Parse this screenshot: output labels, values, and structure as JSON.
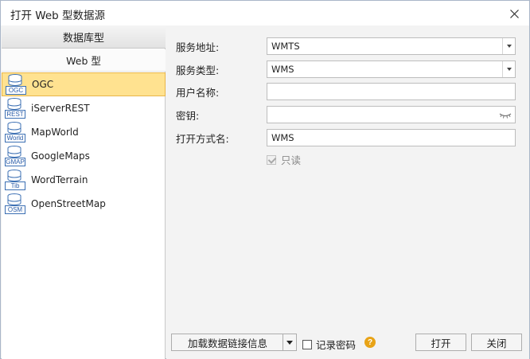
{
  "window": {
    "title": "打开 Web 型数据源"
  },
  "sidebar": {
    "header": "数据库型",
    "group": "Web 型",
    "items": [
      {
        "label": "OGC",
        "tag": "OGC",
        "selected": true,
        "icon": "database-icon"
      },
      {
        "label": "iServerREST",
        "tag": "REST",
        "selected": false,
        "icon": "database-icon"
      },
      {
        "label": "MapWorld",
        "tag": "World",
        "selected": false,
        "icon": "database-icon"
      },
      {
        "label": "GoogleMaps",
        "tag": "GMAP",
        "selected": false,
        "icon": "database-icon"
      },
      {
        "label": "WordTerrain",
        "tag": "Tib",
        "selected": false,
        "icon": "database-icon"
      },
      {
        "label": "OpenStreetMap",
        "tag": "OSM",
        "selected": false,
        "icon": "database-icon"
      }
    ]
  },
  "form": {
    "service_address": {
      "label": "服务地址:",
      "value": "WMTS"
    },
    "service_type": {
      "label": "服务类型:",
      "value": "WMS"
    },
    "username": {
      "label": "用户名称:",
      "value": ""
    },
    "key": {
      "label": "密钥:",
      "value": ""
    },
    "open_alias": {
      "label": "打开方式名:",
      "value": "WMS"
    },
    "readonly": {
      "label": "只读",
      "checked": true,
      "disabled": true
    }
  },
  "footer": {
    "load_label": "加载数据链接信息",
    "remember_label": "记录密码",
    "remember_checked": false,
    "open_label": "打开",
    "close_label": "关闭"
  },
  "colors": {
    "selection_bg": "#ffe290",
    "selection_border": "#e9b64a",
    "icon_blue": "#3b6fb3",
    "help_orange": "#e8a317"
  }
}
